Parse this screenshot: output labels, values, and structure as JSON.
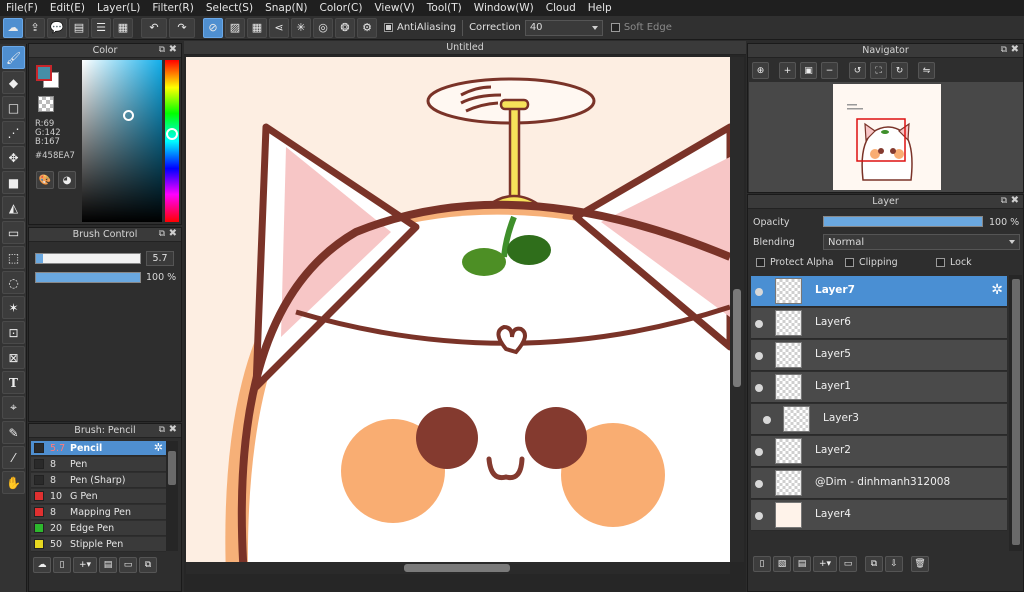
{
  "menu": [
    "File(F)",
    "Edit(E)",
    "Layer(L)",
    "Filter(R)",
    "Select(S)",
    "Snap(N)",
    "Color(C)",
    "View(V)",
    "Tool(T)",
    "Window(W)",
    "Cloud",
    "Help"
  ],
  "toolbar": {
    "antialias_label": "AntiAliasing",
    "correction_label": "Correction",
    "correction_value": "40",
    "soft_edge_label": "Soft Edge"
  },
  "color_panel": {
    "title": "Color",
    "r": "R:69",
    "g": "G:142",
    "b": "B:167",
    "hex": "#458EA7",
    "fg_color": "#458ea7",
    "bg_color": "#ffffff"
  },
  "brush_control": {
    "title": "Brush Control",
    "size_value": "5.7",
    "opacity_value": "100 %",
    "size_fraction": 0.07,
    "opacity_fraction": 1.0
  },
  "brush_list": {
    "title": "Brush: Pencil",
    "items": [
      {
        "size": "5.7",
        "name": "Pencil",
        "color": "#2a2a2a",
        "active": true
      },
      {
        "size": "8",
        "name": "Pen",
        "color": "#2a2a2a"
      },
      {
        "size": "8",
        "name": "Pen (Sharp)",
        "color": "#2a2a2a"
      },
      {
        "size": "10",
        "name": "G Pen",
        "color": "#e03030"
      },
      {
        "size": "8",
        "name": "Mapping Pen",
        "color": "#e03030"
      },
      {
        "size": "20",
        "name": "Edge Pen",
        "color": "#2db82d"
      },
      {
        "size": "50",
        "name": "Stipple Pen",
        "color": "#e8d820"
      }
    ]
  },
  "document": {
    "title": "Untitled"
  },
  "navigator": {
    "title": "Navigator"
  },
  "layer_panel": {
    "title": "Layer",
    "opacity_label": "Opacity",
    "opacity_value": "100 %",
    "blending_label": "Blending",
    "blending_value": "Normal",
    "protect_alpha_label": "Protect Alpha",
    "clipping_label": "Clipping",
    "lock_label": "Lock",
    "layers": [
      {
        "name": "Layer7",
        "active": true
      },
      {
        "name": "Layer6"
      },
      {
        "name": "Layer5"
      },
      {
        "name": "Layer1"
      },
      {
        "name": "Layer3",
        "indent": true
      },
      {
        "name": "Layer2"
      },
      {
        "name": "@Dim - dinhmanh312008"
      },
      {
        "name": "Layer4"
      }
    ]
  }
}
